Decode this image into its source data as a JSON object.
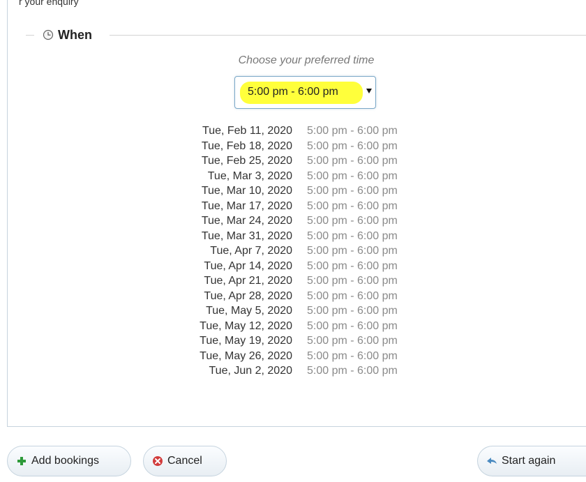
{
  "header": {
    "clipped_text": "r your enquiry"
  },
  "section": {
    "title": "When",
    "icon": "clock-icon",
    "hint": "Choose your preferred time"
  },
  "time_select": {
    "selected": "5:00 pm - 6:00 pm",
    "highlight_color": "#ffff3b"
  },
  "sessions": [
    {
      "date": "Tue, Feb 11, 2020",
      "time": "5:00 pm - 6:00 pm"
    },
    {
      "date": "Tue, Feb 18, 2020",
      "time": "5:00 pm - 6:00 pm"
    },
    {
      "date": "Tue, Feb 25, 2020",
      "time": "5:00 pm - 6:00 pm"
    },
    {
      "date": "Tue, Mar 3, 2020",
      "time": "5:00 pm - 6:00 pm"
    },
    {
      "date": "Tue, Mar 10, 2020",
      "time": "5:00 pm - 6:00 pm"
    },
    {
      "date": "Tue, Mar 17, 2020",
      "time": "5:00 pm - 6:00 pm"
    },
    {
      "date": "Tue, Mar 24, 2020",
      "time": "5:00 pm - 6:00 pm"
    },
    {
      "date": "Tue, Mar 31, 2020",
      "time": "5:00 pm - 6:00 pm"
    },
    {
      "date": "Tue, Apr 7, 2020",
      "time": "5:00 pm - 6:00 pm"
    },
    {
      "date": "Tue, Apr 14, 2020",
      "time": "5:00 pm - 6:00 pm"
    },
    {
      "date": "Tue, Apr 21, 2020",
      "time": "5:00 pm - 6:00 pm"
    },
    {
      "date": "Tue, Apr 28, 2020",
      "time": "5:00 pm - 6:00 pm"
    },
    {
      "date": "Tue, May 5, 2020",
      "time": "5:00 pm - 6:00 pm"
    },
    {
      "date": "Tue, May 12, 2020",
      "time": "5:00 pm - 6:00 pm"
    },
    {
      "date": "Tue, May 19, 2020",
      "time": "5:00 pm - 6:00 pm"
    },
    {
      "date": "Tue, May 26, 2020",
      "time": "5:00 pm - 6:00 pm"
    },
    {
      "date": "Tue, Jun 2, 2020",
      "time": "5:00 pm - 6:00 pm"
    }
  ],
  "buttons": {
    "add": {
      "label": "Add bookings",
      "icon": "plus-icon",
      "color": "#2e9a3a"
    },
    "cancel": {
      "label": "Cancel",
      "icon": "cancel-icon",
      "color": "#d23c3c"
    },
    "restart": {
      "label": "Start again",
      "icon": "back-arrow-icon",
      "color": "#4a8ac0"
    }
  }
}
